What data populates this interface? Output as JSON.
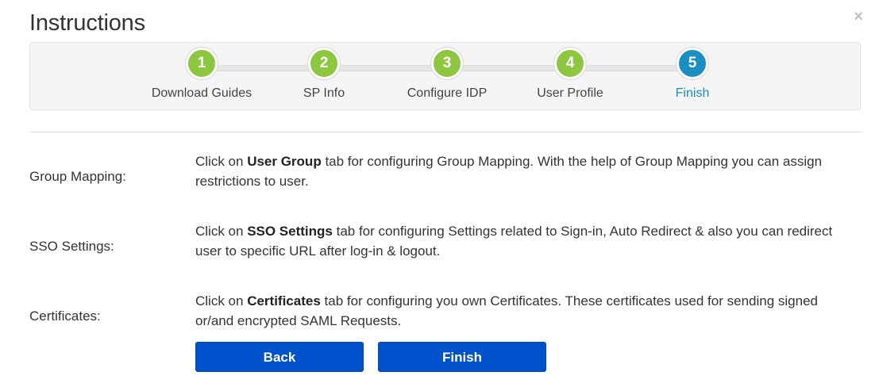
{
  "dialog": {
    "title": "Instructions",
    "close_symbol": "×"
  },
  "wizard": {
    "steps": [
      {
        "number": "1",
        "label": "Download Guides",
        "state": "done"
      },
      {
        "number": "2",
        "label": "SP Info",
        "state": "done"
      },
      {
        "number": "3",
        "label": "Configure IDP",
        "state": "done"
      },
      {
        "number": "4",
        "label": "User Profile",
        "state": "done"
      },
      {
        "number": "5",
        "label": "Finish",
        "state": "active"
      }
    ]
  },
  "rows": [
    {
      "label": "Group Mapping:",
      "pre": "Click on ",
      "bold": "User Group",
      "post": " tab for configuring Group Mapping. With the help of Group Mapping you can assign restrictions to user."
    },
    {
      "label": "SSO Settings:",
      "pre": "Click on ",
      "bold": "SSO Settings",
      "post": " tab for configuring Settings related to Sign-in, Auto Redirect & also you can redirect user to specific URL after log-in & logout."
    },
    {
      "label": "Certificates:",
      "pre": "Click on ",
      "bold": "Certificates",
      "post": " tab for configuring you own Certificates. These certificates used for sending signed or/and encrypted SAML Requests."
    }
  ],
  "buttons": {
    "back": "Back",
    "finish": "Finish"
  },
  "colors": {
    "step_done": "#8dc63f",
    "step_active": "#1a8ec1",
    "button": "#0052cc"
  }
}
